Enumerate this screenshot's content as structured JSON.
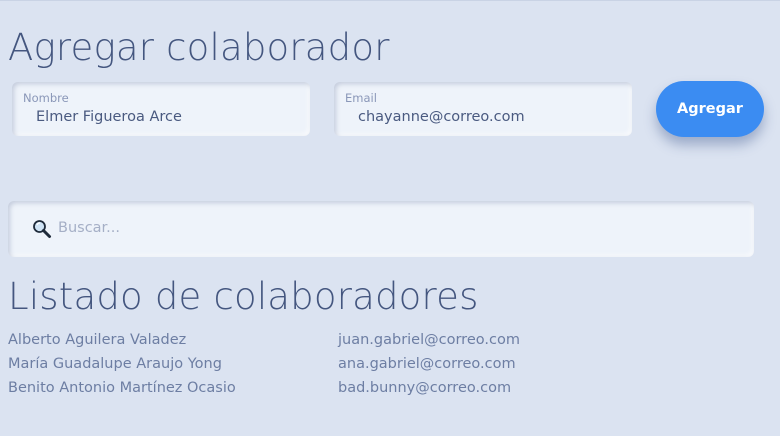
{
  "form": {
    "title": "Agregar colaborador",
    "name_label": "Nombre",
    "name_value": "Elmer Figueroa Arce",
    "email_label": "Email",
    "email_value": "chayanne@correo.com",
    "submit_label": "Agregar"
  },
  "search": {
    "icon": "search-icon",
    "placeholder": "Buscar..."
  },
  "list": {
    "title": "Listado de colaboradores",
    "rows": [
      {
        "name": "Alberto Aguilera Valadez",
        "email": "juan.gabriel@correo.com"
      },
      {
        "name": "María Guadalupe Araujo Yong",
        "email": "ana.gabriel@correo.com"
      },
      {
        "name": "Benito Antonio Martínez Ocasio",
        "email": "bad.bunny@correo.com"
      }
    ]
  },
  "colors": {
    "background": "#dbe3f1",
    "accent": "#3b8cf2",
    "title_text": "#44567f",
    "body_text": "#6d7ea3"
  }
}
